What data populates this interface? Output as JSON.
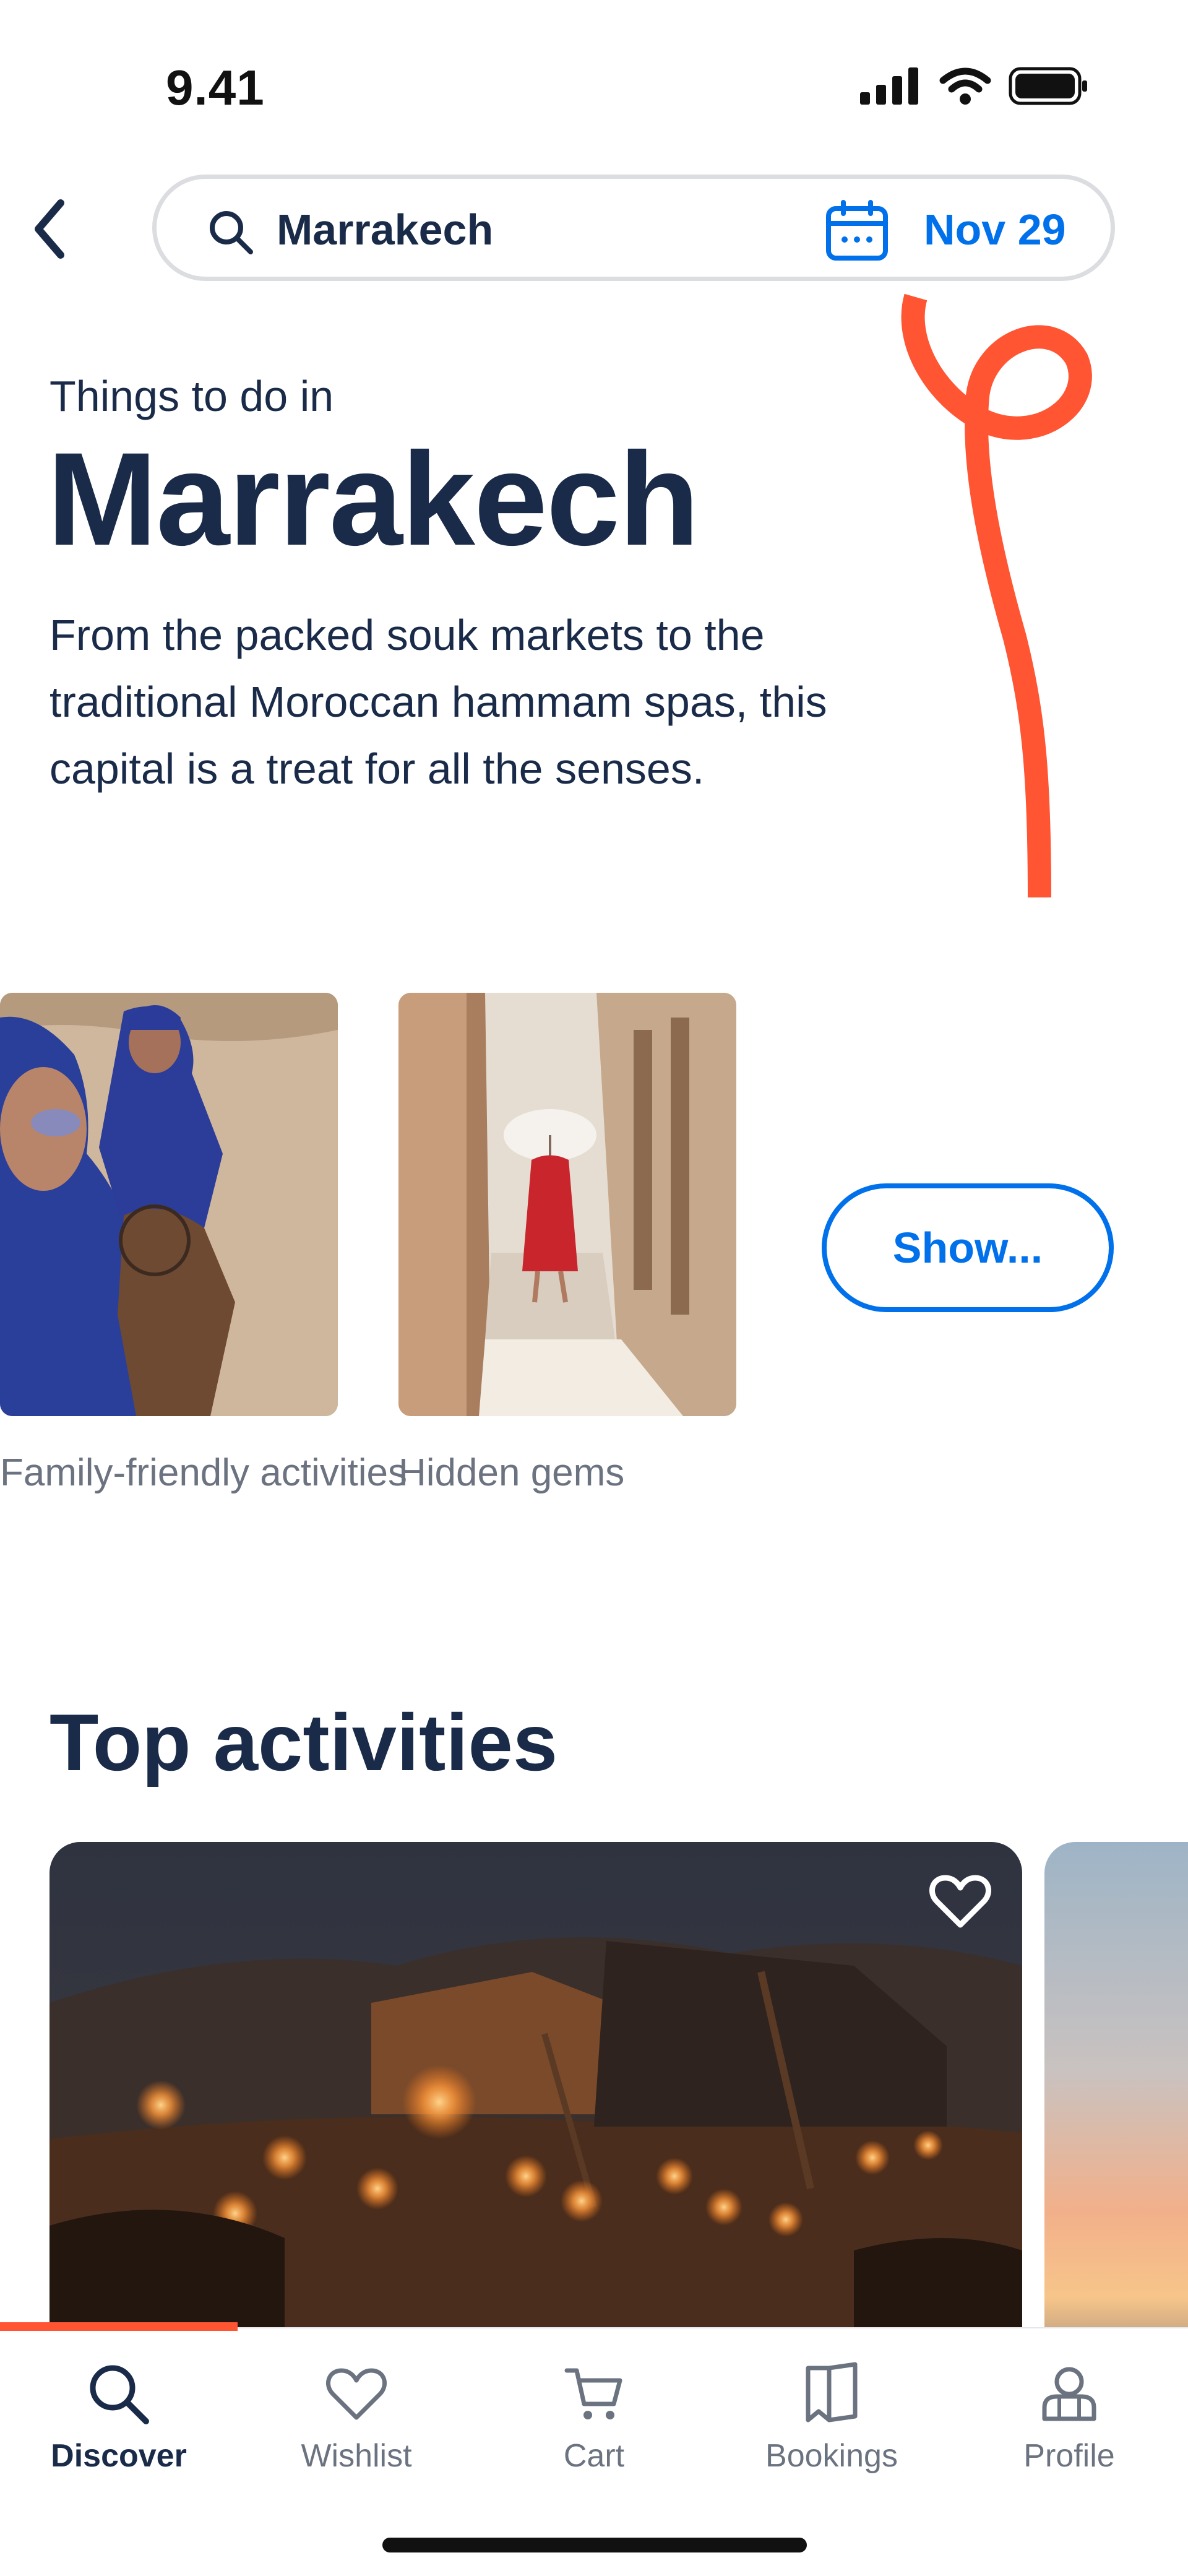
{
  "status_bar": {
    "time": "9.41"
  },
  "search": {
    "query": "Marrakech",
    "date": "Nov 29"
  },
  "hero": {
    "subtitle": "Things to do in",
    "title": "Marrakech",
    "description": "From the packed souk markets to the traditional Moroccan hammam spas, this capital is a treat for all the senses."
  },
  "categories": [
    {
      "label": "Family-friendly activities"
    },
    {
      "label": "Hidden gems"
    }
  ],
  "show_more_label": "Show...",
  "top_activities": {
    "title": "Top activities"
  },
  "tabs": [
    {
      "label": "Discover",
      "icon": "search-icon",
      "active": true
    },
    {
      "label": "Wishlist",
      "icon": "heart-icon"
    },
    {
      "label": "Cart",
      "icon": "cart-icon"
    },
    {
      "label": "Bookings",
      "icon": "bookmark-icon"
    },
    {
      "label": "Profile",
      "icon": "profile-icon"
    }
  ],
  "colors": {
    "accent": "#0071eb",
    "brand": "#ff5533",
    "text": "#1a2b49"
  }
}
